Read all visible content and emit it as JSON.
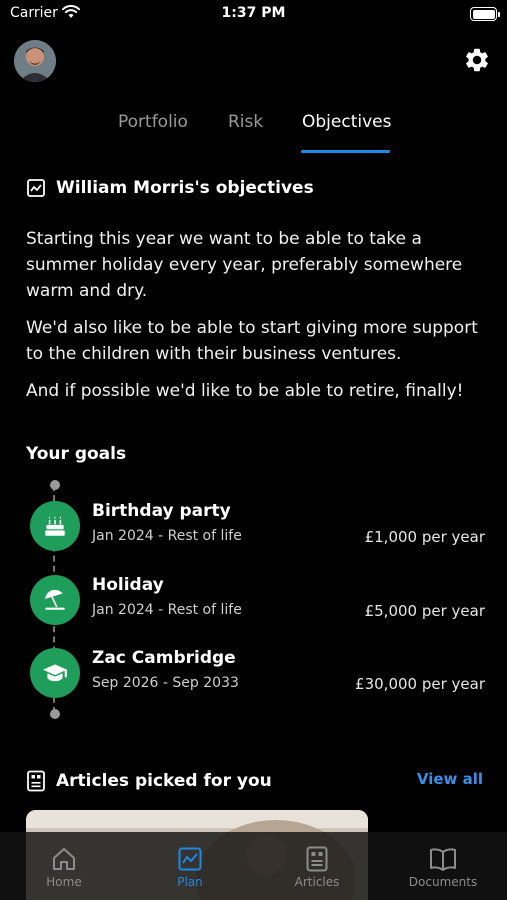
{
  "status_bar": {
    "carrier": "Carrier",
    "time": "1:37 PM"
  },
  "tabs": [
    {
      "label": "Portfolio",
      "active": false
    },
    {
      "label": "Risk",
      "active": false
    },
    {
      "label": "Objectives",
      "active": true
    }
  ],
  "objectives": {
    "title": "William Morris's objectives",
    "paragraphs": [
      "Starting this year we want to be able to take a summer holiday every year, preferably somewhere warm and dry.",
      "We'd also like to be able to start giving more support to the children with their business ventures.",
      "And if possible we'd like to be able to retire, finally!"
    ]
  },
  "goals": {
    "title": "Your goals",
    "items": [
      {
        "name": "Birthday party",
        "dates": "Jan 2024 - Rest of life",
        "amount": "£1,000 per year",
        "icon": "cake-icon"
      },
      {
        "name": "Holiday",
        "dates": "Jan 2024 - Rest of life",
        "amount": "£5,000 per year",
        "icon": "beach-umbrella-icon"
      },
      {
        "name": "Zac Cambridge",
        "dates": "Sep 2026 - Sep 2033",
        "amount": "£30,000 per year",
        "icon": "graduation-cap-icon"
      }
    ]
  },
  "articles": {
    "title": "Articles picked for you",
    "view_all": "View all"
  },
  "tabbar": [
    {
      "label": "Home",
      "icon": "home-icon",
      "active": false
    },
    {
      "label": "Plan",
      "icon": "chart-icon",
      "active": true
    },
    {
      "label": "Articles",
      "icon": "articles-icon",
      "active": false
    },
    {
      "label": "Documents",
      "icon": "book-icon",
      "active": false
    }
  ],
  "colors": {
    "accent": "#1e88e5",
    "goal_green": "#1e9e5a",
    "background": "#000000",
    "link": "#3a8ee6"
  }
}
